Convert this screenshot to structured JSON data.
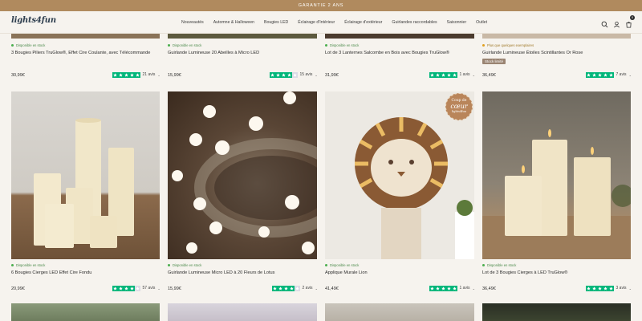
{
  "promo": {
    "text": "GARANTIE 2 ANS"
  },
  "header": {
    "logo": "lights4fun",
    "nav": [
      "Nouveautés",
      "Automne & Halloween",
      "Bougies LED",
      "Éclairage d'Intérieur",
      "Éclairage d'extérieur",
      "Guirlandes raccordables",
      "Saisonnier",
      "Outlet"
    ],
    "cart_count": "0"
  },
  "top_row": [
    {
      "stock": "Disponible en stock",
      "title": "3 Bougies Piliers TruGlow®, Effet Cire Coulante, avec Télécommande",
      "price": "30,99€",
      "reviews": "21 avis",
      "stars": [
        1,
        1,
        1,
        1,
        1
      ]
    },
    {
      "stock": "Disponible en stock",
      "title": "Guirlande Lumineuse 20 Abeilles à Micro LED",
      "price": "15,99€",
      "reviews": "15 avis",
      "stars": [
        1,
        1,
        1,
        1,
        0
      ]
    },
    {
      "stock": "Disponible en stock",
      "title": "Lot de 3 Lanternes Salcombe en Bois avec Bougies TruGlow®",
      "price": "31,99€",
      "reviews": "1 avis",
      "stars": [
        1,
        1,
        1,
        1,
        1
      ]
    },
    {
      "stock": "Plus que quelques exemplaires",
      "title": "Guirlande Lumineuse Étoiles Scintillantes Or Rose",
      "badge": "Stock limité",
      "price": "36,49€",
      "reviews": "7 avis",
      "stars": [
        1,
        1,
        1,
        1,
        1
      ]
    }
  ],
  "products": [
    {
      "stock": "Disponible en stock",
      "title": "6 Bougies Cierges LED Effet Cire Fondu",
      "price": "20,99€",
      "reviews": "57 avis",
      "stars": [
        1,
        1,
        1,
        1,
        0
      ]
    },
    {
      "stock": "Disponible en stock",
      "title": "Guirlande Lumineuse Micro LED à 20 Fleurs de Lotus",
      "price": "15,99€",
      "reviews": "2 avis",
      "stars": [
        1,
        1,
        1,
        1,
        0
      ]
    },
    {
      "stock": "Disponible en stock",
      "title": "Applique Murale Lion",
      "price": "41,49€",
      "reviews": "1 avis",
      "stars": [
        1,
        1,
        1,
        1,
        1
      ],
      "stamp_line1": "Coup de",
      "stamp_line2": "cœur",
      "stamp_line3": "lights4fun"
    },
    {
      "stock": "Disponible en stock",
      "title": "Lot de 3 Bougies Cierges à LED TruGlow®",
      "price": "36,49€",
      "reviews": "3 avis",
      "stars": [
        1,
        1,
        1,
        1,
        1
      ]
    }
  ],
  "colors": {
    "rating_green": "#00b67a",
    "promo_bar": "#b08a5e",
    "stock_green": "#4caf50"
  }
}
